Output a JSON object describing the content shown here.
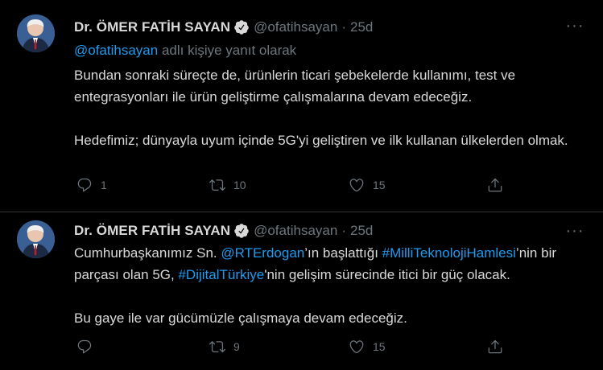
{
  "colors": {
    "background": "#000000",
    "text": "#d9d9d9",
    "muted": "#6e767d",
    "link": "#1d9bf0",
    "divider": "#2f3336",
    "verified": "#d9d9d9"
  },
  "tweets": [
    {
      "name": "Dr. ÖMER FATİH SAYAN",
      "handle": "@ofatihsayan",
      "separator": "·",
      "time": "25d",
      "more_label": "···",
      "reply_to": {
        "mention": "@ofatihsayan",
        "suffix": " adlı kişiye yanıt olarak"
      },
      "text": {
        "p1": "Bundan sonraki süreçte de, ürünlerin ticari şebekelerde kullanımı, test ve entegrasyonları ile ürün geliştirme çalışmalarına devam edeceğiz.",
        "p2": "Hedefimiz; dünyayla uyum içinde 5G'yi geliştiren ve ilk kullanan ülkelerden olmak."
      },
      "counts": {
        "reply": "1",
        "retweet": "10",
        "like": "15"
      },
      "icons": [
        "verified-badge-icon",
        "more-icon",
        "reply-icon",
        "retweet-icon",
        "like-icon",
        "share-icon"
      ]
    },
    {
      "name": "Dr. ÖMER FATİH SAYAN",
      "handle": "@ofatihsayan",
      "separator": "·",
      "time": "25d",
      "more_label": "···",
      "text": {
        "a": "Cumhurbaşkanımız Sn. ",
        "mention": "@RTErdogan",
        "b": "’ın başlattığı ",
        "hashtag1": "#MilliTeknolojiHamlesi",
        "c": "’nin bir parçası olan 5G, ",
        "hashtag2": "#DijitalTürkiye",
        "d": "'nin gelişim sürecinde itici bir güç olacak.",
        "p2": "Bu gaye ile var gücümüzle çalışmaya devam edeceğiz."
      },
      "counts": {
        "reply": "",
        "retweet": "9",
        "like": "15"
      }
    }
  ]
}
